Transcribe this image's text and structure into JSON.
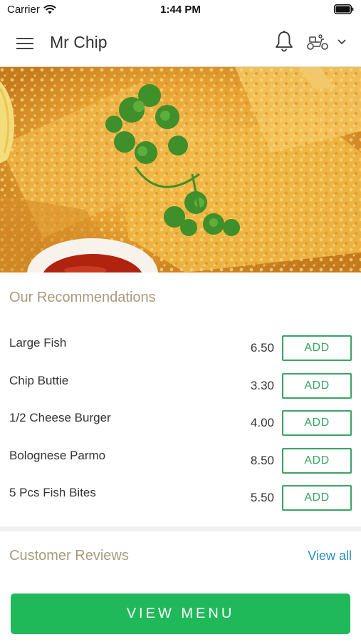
{
  "status_bar": {
    "carrier": "Carrier",
    "time": "1:44 PM"
  },
  "header": {
    "title": "Mr Chip"
  },
  "recommendations": {
    "title": "Our Recommendations",
    "items": [
      {
        "name": "Large Fish",
        "price": "6.50",
        "button": "ADD"
      },
      {
        "name": "Chip Buttie",
        "price": "3.30",
        "button": "ADD"
      },
      {
        "name": "1/2 Cheese Burger",
        "price": "4.00",
        "button": "ADD"
      },
      {
        "name": "Bolognese Parmo",
        "price": "8.50",
        "button": "ADD"
      },
      {
        "name": "5 Pcs Fish Bites",
        "price": "5.50",
        "button": "ADD"
      }
    ]
  },
  "reviews": {
    "title": "Customer Reviews",
    "view_all": "View all"
  },
  "footer": {
    "view_menu": "VIEW MENU"
  },
  "colors": {
    "accent_green": "#1fb95a",
    "link_blue": "#2a8fbf",
    "section_title": "#a99a79"
  },
  "icons": [
    "menu-icon",
    "bell-icon",
    "scooter-icon",
    "chevron-down-icon",
    "wifi-icon",
    "battery-icon"
  ]
}
